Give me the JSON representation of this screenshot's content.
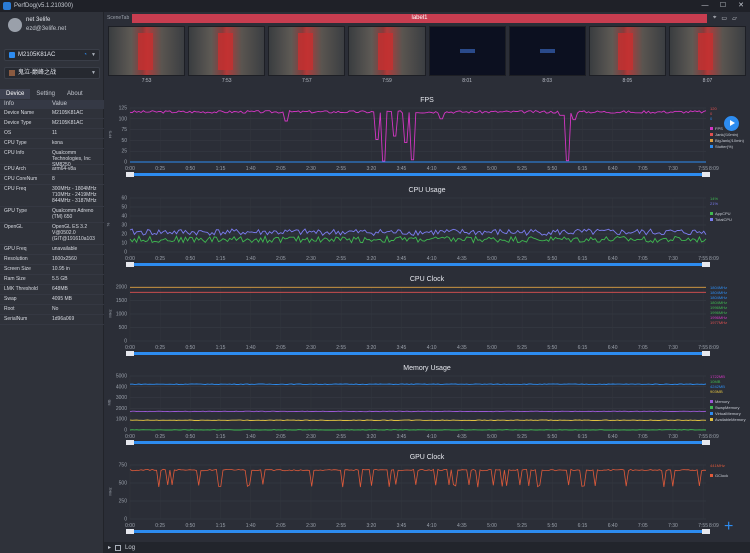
{
  "window": {
    "title": "PerfDog(v5.1.210300)",
    "min": "—",
    "max": "☐",
    "close": "✕"
  },
  "user": {
    "name": "net 3elife",
    "email": "ezd@3elife.net"
  },
  "device": {
    "selected": "M2105K81AC"
  },
  "app": {
    "selected": "鬼泣-巅峰之战"
  },
  "tabs": [
    "Device",
    "Setting",
    "About"
  ],
  "info": {
    "headers": [
      "Info",
      "Value"
    ],
    "rows": [
      [
        "Device Name",
        "M2105K81AC"
      ],
      [
        "Device Type",
        "M2105K81AC"
      ],
      [
        "OS",
        "11"
      ],
      [
        "CPU Type",
        "kona"
      ],
      [
        "CPU Info",
        "Qualcomm Technologies, Inc SM8250"
      ],
      [
        "CPU Arch",
        "arm64-v8a"
      ],
      [
        "CPU CoreNum",
        "8"
      ],
      [
        "CPU Freq",
        "300MHz - 1804MHz 710MHz - 2419MHz 844MHz - 3187MHz"
      ],
      [
        "GPU Type",
        "Qualcomm Adreno (TM) 650"
      ],
      [
        "OpenGL",
        "OpenGL ES 3.2 V@0502.0 (GIT@191610a103"
      ],
      [
        "GPU Freq",
        "unavailable"
      ],
      [
        "Resolution",
        "1600x2560"
      ],
      [
        "Screen Size",
        "10.95 in"
      ],
      [
        "Ram Size",
        "5.5 GB"
      ],
      [
        "LMK Threshold",
        "648MB"
      ],
      [
        "Swap",
        "4095 MB"
      ],
      [
        "Root",
        "No"
      ],
      [
        "SerialNum",
        "1d96a069"
      ]
    ]
  },
  "scene": {
    "tab_label": "SceneTab",
    "label": "label1"
  },
  "thumbnails": {
    "kinds": [
      "street",
      "street",
      "street",
      "street",
      "dark",
      "dark",
      "street",
      "street"
    ],
    "times": [
      "7:53",
      "7:53",
      "7:57",
      "7:59",
      "8:01",
      "8:03",
      "8:05",
      "8:07"
    ]
  },
  "time_axis": {
    "ticks": [
      "0:00",
      "0:25",
      "0:50",
      "1:15",
      "1:40",
      "2:05",
      "2:30",
      "2:55",
      "3:20",
      "3:45",
      "4:10",
      "4:35",
      "5:00",
      "5:25",
      "5:50",
      "6:15",
      "6:40",
      "7:05",
      "7:30",
      "7:55"
    ],
    "end": "8:09",
    "start_badge": "00",
    "end_badge": "8:09"
  },
  "colors": {
    "accent": "#2d8cf0",
    "label_bar": "#c83d50",
    "fps": "#d436c4",
    "cpu_app": "#3fb950",
    "cpu_total": "#7b7cf0",
    "mem": "#9b59d6",
    "gpu": "#e05a3a"
  },
  "charts": [
    {
      "chart_data": {
        "type": "line",
        "title": "FPS",
        "ylabel": "FPS",
        "ylim": [
          0,
          125
        ],
        "yticks": [
          0,
          25,
          50,
          75,
          100,
          125
        ],
        "series": [
          {
            "name": "FPS",
            "color": "#d436c4",
            "level": 116,
            "dips": [
              [
                0.27,
                95
              ],
              [
                0.43,
                52
              ],
              [
                0.44,
                2
              ],
              [
                0.46,
                60
              ],
              [
                0.48,
                45
              ],
              [
                0.49,
                5
              ],
              [
                0.54,
                100
              ],
              [
                0.75,
                108
              ],
              [
                0.76,
                3
              ],
              [
                0.77,
                98
              ],
              [
                0.88,
                114
              ]
            ]
          },
          {
            "name": "Jank(/10min)",
            "color": "#e05050",
            "level": 0
          },
          {
            "name": "BigJank(/10min)",
            "color": "#e0a040",
            "level": 0
          },
          {
            "name": "Stutter(%)",
            "color": "#2d8cf0",
            "level": 0
          }
        ],
        "values_right": [
          {
            "text": "120",
            "color": "#e05050"
          },
          {
            "text": "0",
            "color": "#e05050"
          },
          {
            "text": "0",
            "color": "#2d8cf0"
          }
        ],
        "legend": [
          "FPS",
          "Jank(/10min)",
          "BigJank(/10min)",
          "Stutter(%)"
        ]
      }
    },
    {
      "chart_data": {
        "type": "line",
        "title": "CPU Usage",
        "ylabel": "%",
        "ylim": [
          0,
          60
        ],
        "yticks": [
          0,
          10,
          20,
          30,
          40,
          50,
          60
        ],
        "series": [
          {
            "name": "AppCPU",
            "color": "#3fb950",
            "level": 14
          },
          {
            "name": "TotalCPU",
            "color": "#7b7cf0",
            "level": 22
          }
        ],
        "values_right": [
          {
            "text": "14%",
            "color": "#3fb950"
          },
          {
            "text": "21%",
            "color": "#7b7cf0"
          }
        ],
        "legend": [
          "AppCPU",
          "TotalCPU"
        ]
      }
    },
    {
      "chart_data": {
        "type": "line",
        "title": "CPU Clock",
        "ylabel": "MHz",
        "ylim": [
          0,
          2000
        ],
        "yticks": [
          0,
          500,
          1000,
          1500,
          2000
        ],
        "series": [
          {
            "name": "CPU0",
            "color": "#e05050",
            "level": 1804
          },
          {
            "name": "CPU7",
            "color": "#e0a040",
            "level": 1990
          }
        ],
        "values_right": [
          {
            "text": "1804MHz",
            "color": "#2d8cf0"
          },
          {
            "text": "1804MHz",
            "color": "#2d8cf0"
          },
          {
            "text": "1804MHz",
            "color": "#2d8cf0"
          },
          {
            "text": "1804MHz",
            "color": "#3fb950"
          },
          {
            "text": "1996MHz",
            "color": "#3fb950"
          },
          {
            "text": "1996MHz",
            "color": "#3fb950"
          },
          {
            "text": "1996MHz",
            "color": "#d436c4"
          },
          {
            "text": "1977MHz",
            "color": "#e05050"
          }
        ],
        "legend": []
      }
    },
    {
      "chart_data": {
        "type": "line",
        "title": "Memory Usage",
        "ylabel": "MB",
        "ylim": [
          0,
          5000
        ],
        "yticks": [
          0,
          1000,
          2000,
          3000,
          4000,
          5000
        ],
        "series": [
          {
            "name": "Memory",
            "color": "#9b59d6",
            "level": 1720
          },
          {
            "name": "SwapMemory",
            "color": "#3fb950",
            "level": 10
          },
          {
            "name": "VirtualMemory",
            "color": "#2d8cf0",
            "level": 4240
          },
          {
            "name": "AvailableMemory",
            "color": "#e0c040",
            "level": 900
          }
        ],
        "values_right": [
          {
            "text": "1722MB",
            "color": "#d436c4"
          },
          {
            "text": "10MB",
            "color": "#3fb950"
          },
          {
            "text": "4242MB",
            "color": "#2d8cf0"
          },
          {
            "text": "903MB",
            "color": "#e0c040"
          }
        ],
        "legend": [
          "Memory",
          "SwapMemory",
          "VirtualMemory",
          "AvailableMemory"
        ]
      }
    },
    {
      "chart_data": {
        "type": "line",
        "title": "GPU Clock",
        "ylabel": "MHz",
        "ylim": [
          0,
          750
        ],
        "yticks": [
          0,
          250,
          500,
          750
        ],
        "series": [
          {
            "name": "GClock",
            "color": "#e05a3a",
            "level": 680
          }
        ],
        "values_right": [
          {
            "text": "441MHz",
            "color": "#e05a3a"
          }
        ],
        "legend": [
          "GClock"
        ]
      }
    }
  ],
  "bottom": {
    "log_label": "Log"
  }
}
